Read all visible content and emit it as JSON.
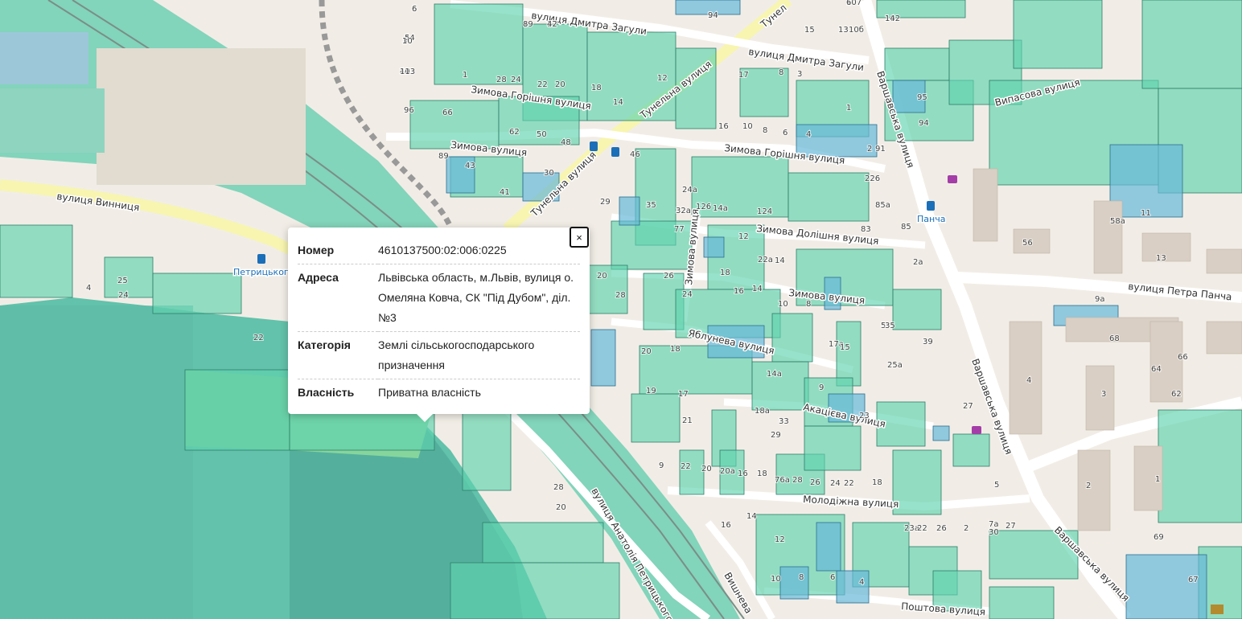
{
  "popup": {
    "rows": [
      {
        "key": "Номер",
        "value": "4610137500:02:006:0225"
      },
      {
        "key": "Адреса",
        "value": "Львівська область, м.Львів, вулиця о. Омеляна Ковча, СК \"Під Дубом\", діл.№3"
      },
      {
        "key": "Категорія",
        "value": "Землі сільськогосподарського призначення"
      },
      {
        "key": "Власність",
        "value": "Приватна власність"
      }
    ],
    "close_label": "×"
  },
  "map": {
    "streets": {
      "vynnytsia": "вулиця Винниця",
      "tunelna1": "Тунельна вулиця",
      "tunelna2": "Тунельна вулиця",
      "tunelna_top": "Тунел",
      "zahuly1": "вулиця Дмитра Загули",
      "zahuly2": "вулиця Дмитра Загули",
      "zymova_horishnia1": "Зимова Горішня вулиця",
      "zymova_horishnia2": "Зимова Горішня вулиця",
      "zymova1": "Зимова вулиця",
      "zymova2": "Зимова вулиця",
      "zymova_dolishnia": "Зимова Долішня вулиця",
      "zymova_vertical": "Зимова вулиця",
      "varshavska1": "Варшавська вулиця",
      "varshavska2": "Варшавська вулиця",
      "varshavska3": "Варшавська вулиця",
      "vypasova": "Випасова вулиця",
      "panchа": "вулиця Петра Панча",
      "yablunева": "Яблунева вулиця",
      "akatsieva": "Акацієва вулиця",
      "molodizhna": "Молодіжна вулиця",
      "petrytskoho": "вулиця Анатолія Петрицького",
      "poshtova": "Поштова вулиця",
      "vyshneva": "Вишнева"
    },
    "poi": {
      "pancha_stop": "Панча",
      "petrytskoho_stop": "Петрицьког"
    },
    "house_numbers": [
      "5",
      "4",
      "47",
      "24",
      "107",
      "102",
      "3",
      "19",
      "17",
      "15",
      "13",
      "10б",
      "103",
      "1",
      "28",
      "24",
      "22",
      "20",
      "18",
      "14",
      "12",
      "17",
      "8",
      "3",
      "1",
      "95",
      "94",
      "96",
      "66",
      "62",
      "50",
      "48",
      "46",
      "16",
      "10",
      "8",
      "6",
      "4",
      "2",
      "91",
      "89",
      "43",
      "41",
      "30",
      "29",
      "35",
      "24а",
      "32а",
      "126",
      "124",
      "226",
      "85а",
      "85",
      "83",
      "2а",
      "77",
      "14а",
      "12",
      "22а",
      "14",
      "20",
      "28",
      "26",
      "24",
      "18",
      "16",
      "14",
      "10",
      "8",
      "5",
      "4",
      "25",
      "24",
      "22",
      "20",
      "18",
      "14а",
      "18а",
      "9",
      "33",
      "29",
      "23",
      "21",
      "19",
      "17",
      "17а",
      "15",
      "25а",
      "35",
      "39",
      "27",
      "5",
      "4",
      "3",
      "2",
      "1",
      "69",
      "67",
      "68",
      "66",
      "64",
      "62",
      "58а",
      "56",
      "13",
      "11",
      "9а",
      "9",
      "22",
      "20",
      "20а",
      "16",
      "18",
      "76а",
      "28",
      "26",
      "24",
      "22",
      "18",
      "16",
      "14",
      "12",
      "10",
      "8",
      "6",
      "4",
      "2",
      "30",
      "27",
      "23а",
      "22",
      "26",
      "28",
      "20",
      "7а",
      "6",
      "54",
      "11",
      "9",
      "6",
      "14",
      "10",
      "8",
      "42"
    ]
  }
}
